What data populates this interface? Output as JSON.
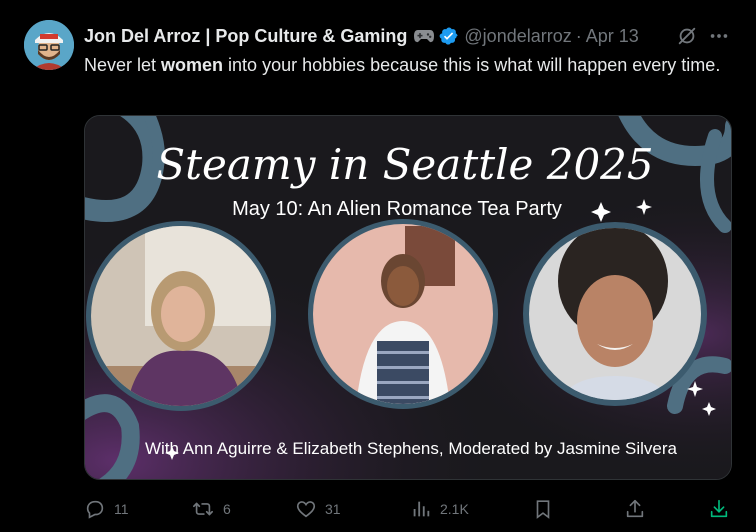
{
  "tweet": {
    "author": {
      "display_name": "Jon Del Arroz | Pop Culture & Gaming",
      "handle": "@jondelarroz",
      "avatar_icon": "avatar-cartoon",
      "verified": true
    },
    "separator": "·",
    "date": "Apr 13",
    "text": {
      "before": "Never let ",
      "bold": "women",
      "after": " into your hobbies because this is what will happen every time."
    },
    "media": {
      "title": "Steamy in Seattle 2025",
      "subtitle": "May 10: An Alien Romance Tea Party",
      "caption": "With Ann Aguirre & Elizabeth Stephens, Moderated by Jasmine Silvera"
    },
    "actions": {
      "reply_count": "11",
      "retweet_count": "6",
      "like_count": "31",
      "views_count": "2.1K"
    },
    "colors": {
      "background": "#000000",
      "text": "#e7e9ea",
      "muted": "#71767b",
      "verified": "#1d9bf0",
      "download": "#00ba7c",
      "tentacle": "#4f6f82"
    }
  }
}
